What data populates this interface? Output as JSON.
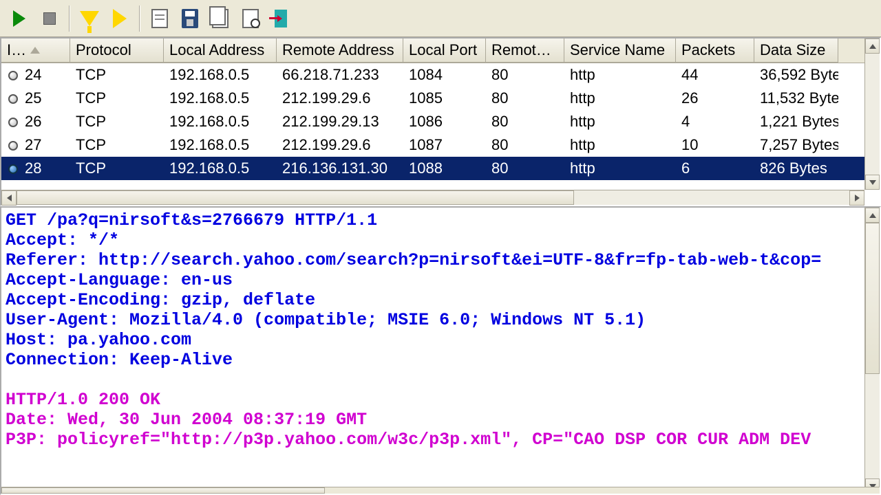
{
  "columns": {
    "idx": "I…",
    "protocol": "Protocol",
    "local": "Local Address",
    "remote": "Remote Address",
    "lport": "Local Port",
    "rport": "Remot…",
    "service": "Service Name",
    "packets": "Packets",
    "size": "Data Size"
  },
  "rows": [
    {
      "idx": "24",
      "proto": "TCP",
      "local": "192.168.0.5",
      "remote": "66.218.71.233",
      "lport": "1084",
      "rport": "80",
      "svc": "http",
      "pkts": "44",
      "size": "36,592 Byte"
    },
    {
      "idx": "25",
      "proto": "TCP",
      "local": "192.168.0.5",
      "remote": "212.199.29.6",
      "lport": "1085",
      "rport": "80",
      "svc": "http",
      "pkts": "26",
      "size": "11,532 Byte"
    },
    {
      "idx": "26",
      "proto": "TCP",
      "local": "192.168.0.5",
      "remote": "212.199.29.13",
      "lport": "1086",
      "rport": "80",
      "svc": "http",
      "pkts": "4",
      "size": "1,221 Bytes"
    },
    {
      "idx": "27",
      "proto": "TCP",
      "local": "192.168.0.5",
      "remote": "212.199.29.6",
      "lport": "1087",
      "rport": "80",
      "svc": "http",
      "pkts": "10",
      "size": "7,257 Bytes"
    },
    {
      "idx": "28",
      "proto": "TCP",
      "local": "192.168.0.5",
      "remote": "216.136.131.30",
      "lport": "1088",
      "rport": "80",
      "svc": "http",
      "pkts": "6",
      "size": "826 Bytes"
    }
  ],
  "selected_row": 4,
  "request_text": "GET /pa?q=nirsoft&s=2766679 HTTP/1.1\nAccept: */*\nReferer: http://search.yahoo.com/search?p=nirsoft&ei=UTF-8&fr=fp-tab-web-t&cop=\nAccept-Language: en-us\nAccept-Encoding: gzip, deflate\nUser-Agent: Mozilla/4.0 (compatible; MSIE 6.0; Windows NT 5.1)\nHost: pa.yahoo.com\nConnection: Keep-Alive\n\n",
  "response_text": "HTTP/1.0 200 OK\nDate: Wed, 30 Jun 2004 08:37:19 GMT\nP3P: policyref=\"http://p3p.yahoo.com/w3c/p3p.xml\", CP=\"CAO DSP COR CUR ADM DEV"
}
